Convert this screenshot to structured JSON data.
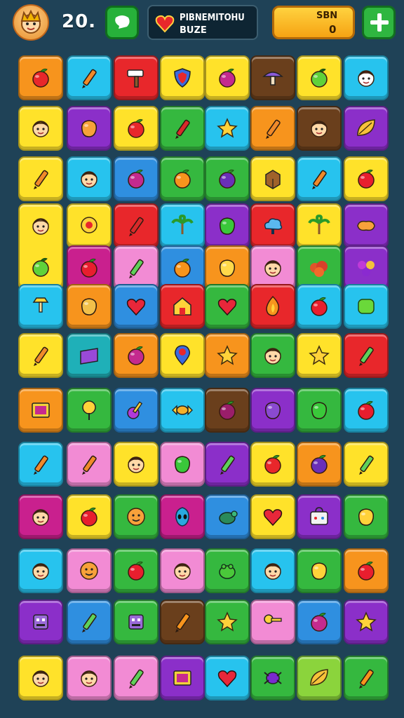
{
  "hud": {
    "score": "20.",
    "banner_line1": "PIBNEMITOHU",
    "banner_line2": "BUZE",
    "coins_label": "SBN",
    "coins_value": "0"
  },
  "colors": {
    "background": "#1f4257",
    "tiles": {
      "orange": "#f7941d",
      "cyan": "#27c3ee",
      "red": "#e8272b",
      "yellow": "#ffe22a",
      "brown": "#6a3f1c",
      "green": "#35b83f",
      "purple": "#8b2fc9",
      "pink": "#f28bd4",
      "blue": "#2f8fe0",
      "magenta": "#c9208e",
      "lime": "#8bd43c",
      "teal": "#1fb0b8"
    }
  },
  "board": {
    "rows": [
      [
        {
          "c": "orange",
          "i": "strawberry-icon"
        },
        {
          "c": "cyan",
          "i": "pencil-icon"
        },
        {
          "c": "red",
          "i": "hammer-icon"
        },
        {
          "c": "yellow",
          "i": "shield-icon"
        },
        {
          "c": "yellow",
          "i": "berry-icon"
        },
        {
          "c": "brown",
          "i": "mushroom-icon"
        },
        {
          "c": "yellow",
          "i": "green-apple-icon"
        },
        {
          "c": "cyan",
          "i": "clown-face-icon"
        }
      ],
      [
        {
          "c": "yellow",
          "i": "princess-face-icon"
        },
        {
          "c": "purple",
          "i": "mango-icon"
        },
        {
          "c": "yellow",
          "i": "strawberry-icon"
        },
        {
          "c": "green",
          "i": "pepper-icon"
        },
        {
          "c": "cyan",
          "i": "star-icon"
        },
        {
          "c": "orange",
          "i": "crayon-icon"
        },
        {
          "c": "brown",
          "i": "boy-face-icon"
        },
        {
          "c": "purple",
          "i": "leaf-icon"
        }
      ],
      [
        {
          "c": "yellow",
          "i": "crayon-icon"
        },
        {
          "c": "cyan",
          "i": "boy-face-icon"
        },
        {
          "c": "blue",
          "i": "berry-icon"
        },
        {
          "c": "green",
          "i": "orange-fruit-icon"
        },
        {
          "c": "green",
          "i": "eggplant-icon"
        },
        {
          "c": "yellow",
          "i": "crate-icon"
        },
        {
          "c": "cyan",
          "i": "crayon-icon"
        },
        {
          "c": "yellow",
          "i": "red-apple-icon"
        }
      ],
      [
        {
          "c": "yellow",
          "i": "bald-face-icon",
          "tall": true,
          "i2": "green-apple-icon"
        },
        {
          "c": "yellow",
          "i": "snail-icon"
        },
        {
          "c": "red",
          "i": "cucumber-icon"
        },
        {
          "c": "cyan",
          "i": "palm-tree-icon"
        },
        {
          "c": "purple",
          "i": "green-leaf-icon"
        },
        {
          "c": "red",
          "i": "cloud-icon"
        },
        {
          "c": "yellow",
          "i": "palm-tree-icon"
        },
        {
          "c": "purple",
          "i": "dog-icon"
        }
      ],
      [
        {
          "c": "magenta",
          "i": "red-apple-icon"
        },
        {
          "c": "pink",
          "i": "popsicle-icon"
        },
        {
          "c": "blue",
          "i": "orange-fruit-icon"
        },
        {
          "c": "orange",
          "i": "pear-icon"
        },
        {
          "c": "pink",
          "i": "boy-face-icon"
        },
        {
          "c": "green",
          "i": "bush-icon"
        },
        {
          "c": "purple",
          "i": "flower-icon"
        }
      ],
      [
        {
          "c": "cyan",
          "i": "lamp-icon"
        },
        {
          "c": "orange",
          "i": "melon-icon"
        },
        {
          "c": "blue",
          "i": "heart-icon"
        },
        {
          "c": "red",
          "i": "house-icon"
        },
        {
          "c": "green",
          "i": "heart-icon"
        },
        {
          "c": "red",
          "i": "fire-icon"
        },
        {
          "c": "cyan",
          "i": "red-apple-icon"
        },
        {
          "c": "cyan",
          "i": "green-square-icon"
        }
      ],
      [
        {
          "c": "yellow",
          "i": "crayon-icon"
        },
        {
          "c": "teal",
          "i": "ribbon-icon"
        },
        {
          "c": "orange",
          "i": "berry-icon"
        },
        {
          "c": "yellow",
          "i": "map-pin-icon"
        },
        {
          "c": "orange",
          "i": "star-icon"
        },
        {
          "c": "green",
          "i": "boy-face-icon"
        },
        {
          "c": "yellow",
          "i": "star-icon"
        },
        {
          "c": "red",
          "i": "popsicle-icon"
        }
      ],
      [
        {
          "c": "orange",
          "i": "picture-icon"
        },
        {
          "c": "green",
          "i": "lollipop-icon"
        },
        {
          "c": "blue",
          "i": "guitar-icon"
        },
        {
          "c": "cyan",
          "i": "candy-icon"
        },
        {
          "c": "brown",
          "i": "beet-icon"
        },
        {
          "c": "purple",
          "i": "potato-icon"
        },
        {
          "c": "green",
          "i": "green-leaf-icon"
        },
        {
          "c": "cyan",
          "i": "red-apple-icon"
        }
      ],
      [
        {
          "c": "cyan",
          "i": "crayon-icon"
        },
        {
          "c": "pink",
          "i": "crayon-icon"
        },
        {
          "c": "yellow",
          "i": "boy-face-icon"
        },
        {
          "c": "pink",
          "i": "green-leaf-icon"
        },
        {
          "c": "purple",
          "i": "popsicle-icon"
        },
        {
          "c": "yellow",
          "i": "strawberry-icon"
        },
        {
          "c": "orange",
          "i": "eggplant-icon"
        },
        {
          "c": "yellow",
          "i": "popsicle-icon"
        }
      ],
      [
        {
          "c": "magenta",
          "i": "princess-face-icon"
        },
        {
          "c": "yellow",
          "i": "red-apple-icon"
        },
        {
          "c": "green",
          "i": "smile-icon"
        },
        {
          "c": "magenta",
          "i": "alien-icon"
        },
        {
          "c": "blue",
          "i": "turtle-icon"
        },
        {
          "c": "yellow",
          "i": "heart-icon"
        },
        {
          "c": "purple",
          "i": "bag-icon"
        },
        {
          "c": "green",
          "i": "lemon-icon"
        }
      ],
      [
        {
          "c": "cyan",
          "i": "boy-face-icon"
        },
        {
          "c": "pink",
          "i": "smile-icon"
        },
        {
          "c": "green",
          "i": "red-apple-icon"
        },
        {
          "c": "pink",
          "i": "boy-face-icon"
        },
        {
          "c": "green",
          "i": "frog-icon"
        },
        {
          "c": "cyan",
          "i": "boy-face-icon"
        },
        {
          "c": "green",
          "i": "lemon-icon"
        },
        {
          "c": "orange",
          "i": "red-apple-icon"
        }
      ],
      [
        {
          "c": "purple",
          "i": "robot-icon"
        },
        {
          "c": "blue",
          "i": "popsicle-icon"
        },
        {
          "c": "green",
          "i": "robot-icon"
        },
        {
          "c": "brown",
          "i": "carrot-icon"
        },
        {
          "c": "green",
          "i": "star-icon"
        },
        {
          "c": "pink",
          "i": "key-icon"
        },
        {
          "c": "blue",
          "i": "berry-icon"
        },
        {
          "c": "purple",
          "i": "star-icon"
        }
      ],
      [
        {
          "c": "yellow",
          "i": "girl-face-icon"
        },
        {
          "c": "pink",
          "i": "princess-face-icon"
        },
        {
          "c": "pink",
          "i": "popsicle-icon"
        },
        {
          "c": "purple",
          "i": "picture-icon"
        },
        {
          "c": "cyan",
          "i": "heart-icon"
        },
        {
          "c": "green",
          "i": "spider-icon"
        },
        {
          "c": "lime",
          "i": "leaf-icon"
        },
        {
          "c": "green",
          "i": "carrot-icon"
        }
      ]
    ]
  }
}
